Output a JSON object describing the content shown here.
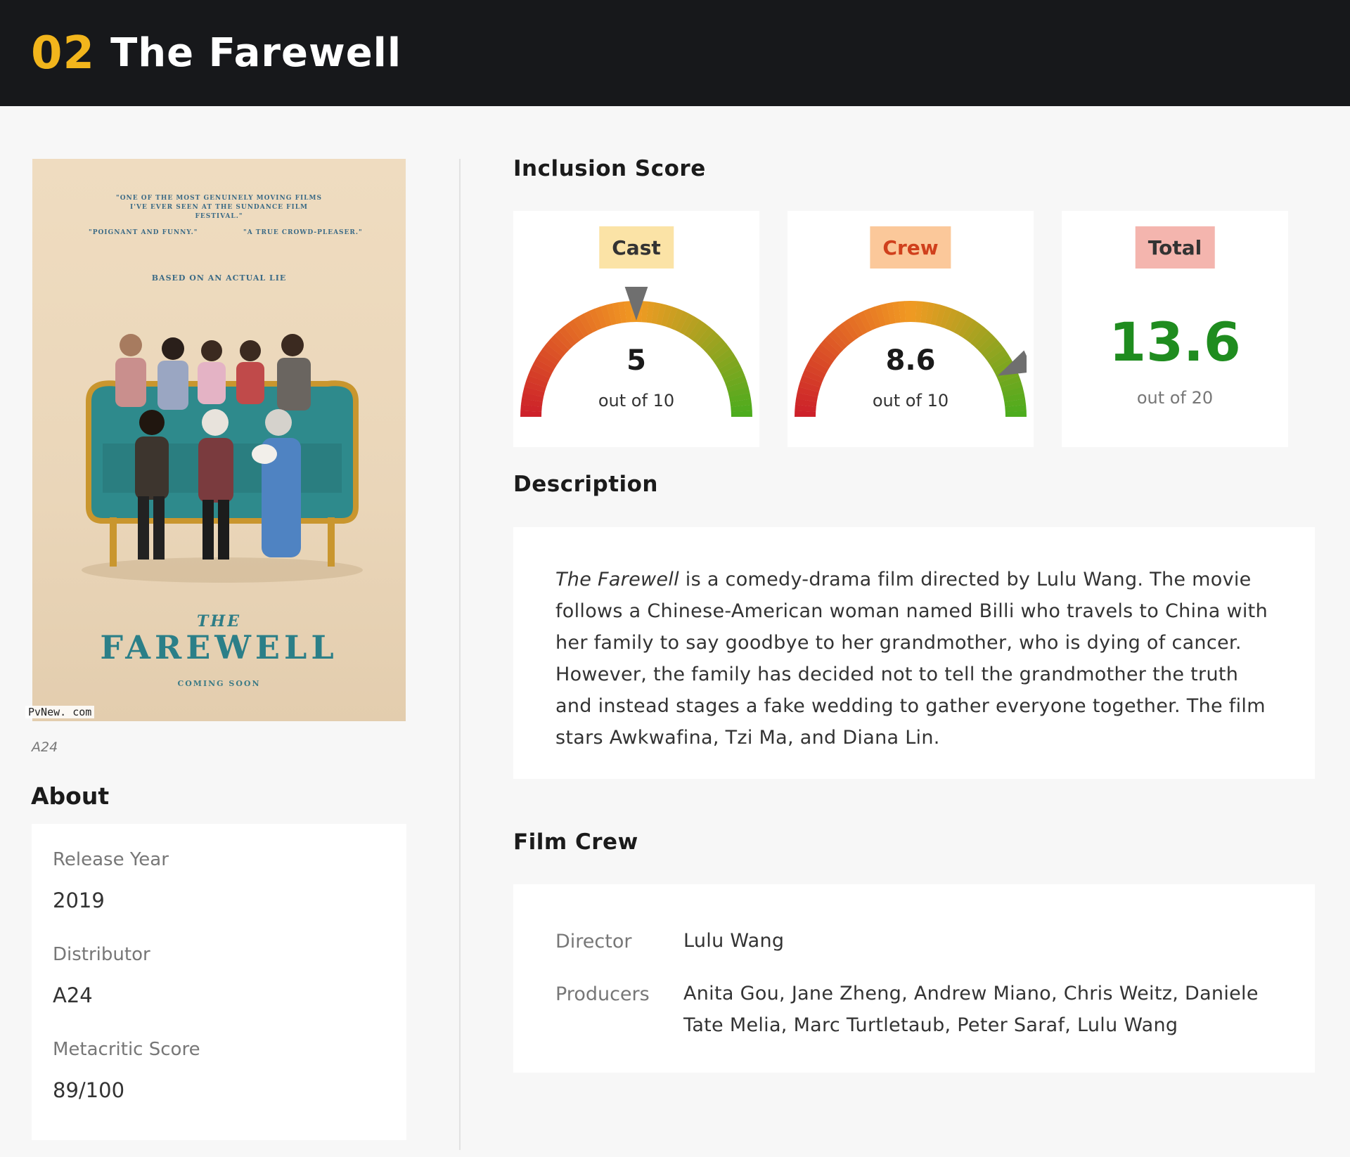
{
  "header": {
    "rank": "02",
    "title": "The Farewell"
  },
  "poster": {
    "quote_1": "\"ONE OF THE MOST GENUINELY MOVING FILMS I'VE EVER SEEN AT THE SUNDANCE FILM FESTIVAL.\"",
    "quote_2": "\"POIGNANT AND FUNNY.\"",
    "quote_3": "\"A TRUE CROWD-PLEASER.\"",
    "tagline": "BASED ON AN ACTUAL LIE",
    "title_small": "THE",
    "title": "FAREWELL",
    "coming_soon": "COMING SOON",
    "watermark": "PvNew. com",
    "caption": "A24"
  },
  "about": {
    "heading": "About",
    "fields": [
      {
        "label": "Release Year",
        "value": "2019"
      },
      {
        "label": "Distributor",
        "value": "A24"
      },
      {
        "label": "Metacritic Score",
        "value": "89/100"
      }
    ]
  },
  "inclusion": {
    "heading": "Inclusion Score",
    "cast": {
      "label": "Cast",
      "score": 5,
      "display": "5",
      "sub": "out of 10",
      "max": 10,
      "badge_bg": "#fbe3a6",
      "badge_fg": "#333333"
    },
    "crew": {
      "label": "Crew",
      "score": 8.6,
      "display": "8.6",
      "sub": "out of 10",
      "max": 10,
      "badge_bg": "#fbc89a",
      "badge_fg": "#d0401c"
    },
    "total": {
      "label": "Total",
      "display": "13.6",
      "sub": "out of 20",
      "badge_bg": "#f4b5ae",
      "badge_fg": "#333333",
      "value_color": "#1f8c1f"
    }
  },
  "description": {
    "heading": "Description",
    "title_italic": "The Farewell",
    "text": " is a comedy-drama film directed by Lulu Wang. The movie follows a Chinese-American woman named Billi who travels to China with her family to say goodbye to her grandmother, who is dying of cancer. However, the family has decided not to tell the grandmother the truth and instead stages a fake wedding to gather everyone together. The film stars Awkwafina, Tzi Ma, and Diana Lin."
  },
  "film_crew": {
    "heading": "Film Crew",
    "rows": [
      {
        "label": "Director",
        "value": "Lulu Wang"
      },
      {
        "label": "Producers",
        "value": "Anita Gou, Jane Zheng, Andrew Miano, Chris Weitz, Daniele Tate Melia, Marc Turtletaub, Peter Saraf, Lulu Wang"
      }
    ]
  },
  "colors": {
    "accent": "#f2b51c",
    "header_bg": "#17181b",
    "gauge_low": "#cc1f2a",
    "gauge_mid": "#f19a22",
    "gauge_high": "#4aac1e"
  },
  "icons": {
    "gauge_pointer": "triangle-pointer-icon"
  }
}
